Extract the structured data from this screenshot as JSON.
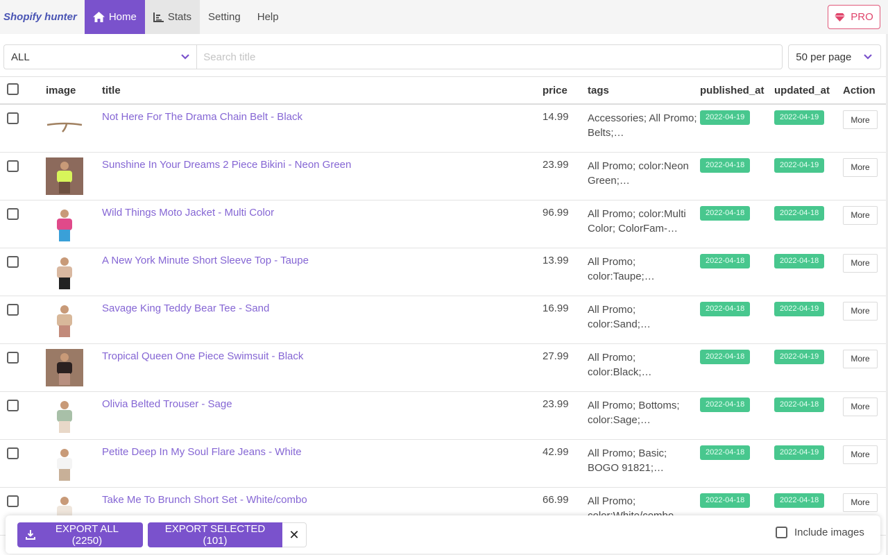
{
  "navbar": {
    "brand": "Shopify hunter",
    "items": [
      {
        "label": "Home",
        "icon": "home-icon",
        "active": true
      },
      {
        "label": "Stats",
        "icon": "bar-chart-icon",
        "active": false
      },
      {
        "label": "Setting",
        "icon": null,
        "active": false
      },
      {
        "label": "Help",
        "icon": null,
        "active": false
      }
    ],
    "pro_label": "PRO",
    "pro_icon": "gem-icon"
  },
  "filters": {
    "collection_selected": "ALL",
    "search_placeholder": "Search title",
    "search_value": "",
    "per_page_selected": "50 per page"
  },
  "table": {
    "columns": [
      "image",
      "title",
      "price",
      "tags",
      "published_at",
      "updated_at",
      "Action"
    ],
    "rows": [
      {
        "title": "Not Here For The Drama Chain Belt - Black",
        "price": "14.99",
        "tags": "Accessories; All Promo; Belts;…",
        "published_at": "2022-04-19",
        "updated_at": "2022-04-19",
        "action": "More",
        "image": "chain-belt"
      },
      {
        "title": "Sunshine In Your Dreams 2 Piece Bikini - Neon Green",
        "price": "23.99",
        "tags": "All Promo; color:Neon Green;…",
        "published_at": "2022-04-18",
        "updated_at": "2022-04-19",
        "action": "More",
        "image": "bikini"
      },
      {
        "title": "Wild Things Moto Jacket - Multi Color",
        "price": "96.99",
        "tags": "All Promo; color:Multi Color; ColorFam-…",
        "published_at": "2022-04-18",
        "updated_at": "2022-04-18",
        "action": "More",
        "image": "jacket"
      },
      {
        "title": "A New York Minute Short Sleeve Top - Taupe",
        "price": "13.99",
        "tags": "All Promo; color:Taupe;…",
        "published_at": "2022-04-18",
        "updated_at": "2022-04-18",
        "action": "More",
        "image": "top"
      },
      {
        "title": "Savage King Teddy Bear Tee - Sand",
        "price": "16.99",
        "tags": "All Promo; color:Sand;…",
        "published_at": "2022-04-18",
        "updated_at": "2022-04-19",
        "action": "More",
        "image": "tee"
      },
      {
        "title": "Tropical Queen One Piece Swimsuit - Black",
        "price": "27.99",
        "tags": "All Promo; color:Black;…",
        "published_at": "2022-04-18",
        "updated_at": "2022-04-19",
        "action": "More",
        "image": "swimsuit"
      },
      {
        "title": "Olivia Belted Trouser - Sage",
        "price": "23.99",
        "tags": "All Promo; Bottoms; color:Sage;…",
        "published_at": "2022-04-18",
        "updated_at": "2022-04-18",
        "action": "More",
        "image": "trouser"
      },
      {
        "title": "Petite Deep In My Soul Flare Jeans - White",
        "price": "42.99",
        "tags": "All Promo; Basic; BOGO 91821;…",
        "published_at": "2022-04-18",
        "updated_at": "2022-04-19",
        "action": "More",
        "image": "jeans"
      },
      {
        "title": "Take Me To Brunch Short Set - White/combo",
        "price": "66.99",
        "tags": "All Promo; color:White/combo…",
        "published_at": "2022-04-18",
        "updated_at": "2022-04-18",
        "action": "More",
        "image": "short-set"
      }
    ]
  },
  "export_bar": {
    "export_all_label": "EXPORT ALL (2250)",
    "export_selected_label": "EXPORT SELECTED (101)",
    "clear_label": "✕",
    "include_images_label": "Include images",
    "include_images_checked": false
  },
  "colors": {
    "accent": "#7a52cc",
    "brand_text": "#4a55b4",
    "link": "#8566d4",
    "date_tag": "#48c78e",
    "pro": "#e0456b"
  }
}
